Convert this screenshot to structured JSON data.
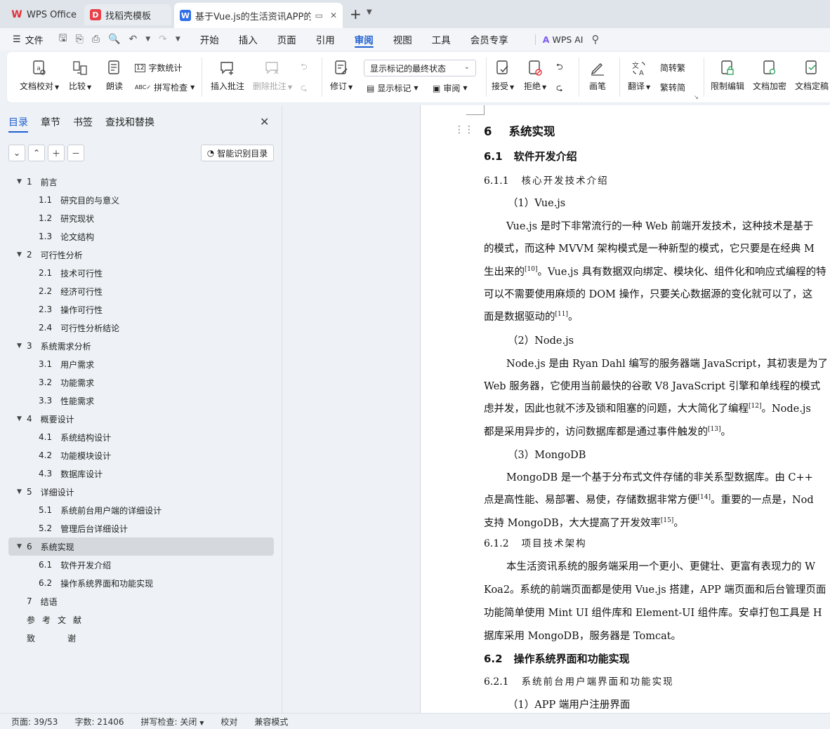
{
  "tabs": [
    {
      "label": "WPS Office",
      "icon": "wps-logo-icon"
    },
    {
      "label": "找稻壳模板",
      "icon": "docer-icon"
    },
    {
      "label": "基于Vue.js的生活资讯APP的设",
      "icon": "writer-doc-icon"
    }
  ],
  "menu": {
    "file_label": "文件",
    "tabs": [
      "开始",
      "插入",
      "页面",
      "引用",
      "审阅",
      "视图",
      "工具",
      "会员专享"
    ],
    "active_tab": "审阅",
    "ai_label": "WPS AI"
  },
  "ribbon": {
    "doc_check": "文档校对",
    "compare": "比较",
    "read_aloud": "朗读",
    "word_count": "字数统计",
    "spell_check": "拼写检查",
    "insert_comment": "插入批注",
    "delete_comment": "删除批注",
    "track_changes": "修订",
    "markup_state": "显示标记的最终状态",
    "show_markup": "显示标记",
    "review_pane": "审阅",
    "accept": "接受",
    "reject": "拒绝",
    "pen": "画笔",
    "translate": "翻译",
    "to_traditional": "简转繁",
    "to_simplified": "繁转简",
    "restrict_edit": "限制编辑",
    "encrypt": "文档加密",
    "finalize": "文档定稿"
  },
  "nav": {
    "tabs": [
      "目录",
      "章节",
      "书签",
      "查找和替换"
    ],
    "active_tab": "目录",
    "smart_toc": "智能识别目录",
    "toc": [
      {
        "num": "1",
        "title": "前言",
        "level": 1,
        "arrow": true
      },
      {
        "num": "1.1",
        "title": "研究目的与意义",
        "level": 2
      },
      {
        "num": "1.2",
        "title": "研究现状",
        "level": 2
      },
      {
        "num": "1.3",
        "title": "论文结构",
        "level": 2
      },
      {
        "num": "2",
        "title": "可行性分析",
        "level": 1,
        "arrow": true
      },
      {
        "num": "2.1",
        "title": "技术可行性",
        "level": 2
      },
      {
        "num": "2.2",
        "title": "经济可行性",
        "level": 2
      },
      {
        "num": "2.3",
        "title": "操作可行性",
        "level": 2
      },
      {
        "num": "2.4",
        "title": "可行性分析结论",
        "level": 2
      },
      {
        "num": "3",
        "title": "系统需求分析",
        "level": 1,
        "arrow": true
      },
      {
        "num": "3.1",
        "title": "用户需求",
        "level": 2
      },
      {
        "num": "3.2",
        "title": "功能需求",
        "level": 2
      },
      {
        "num": "3.3",
        "title": "性能需求",
        "level": 2
      },
      {
        "num": "4",
        "title": "概要设计",
        "level": 1,
        "arrow": true
      },
      {
        "num": "4.1",
        "title": "系统结构设计",
        "level": 2
      },
      {
        "num": "4.2",
        "title": "功能模块设计",
        "level": 2
      },
      {
        "num": "4.3",
        "title": "数据库设计",
        "level": 2
      },
      {
        "num": "5",
        "title": "详细设计",
        "level": 1,
        "arrow": true
      },
      {
        "num": "5.1",
        "title": "系统前台用户端的详细设计",
        "level": 2
      },
      {
        "num": "5.2",
        "title": "管理后台详细设计",
        "level": 2
      },
      {
        "num": "6",
        "title": "系统实现",
        "level": 1,
        "arrow": true,
        "selected": true
      },
      {
        "num": "6.1",
        "title": "软件开发介绍",
        "level": 2
      },
      {
        "num": "6.2",
        "title": "操作系统界面和功能实现",
        "level": 2
      },
      {
        "num": "7",
        "title": "结语",
        "level": 1,
        "arrow": false
      },
      {
        "num": "",
        "title": "参考文献",
        "level": 1,
        "arrow": false,
        "spaced": true
      },
      {
        "num": "",
        "title": "致谢",
        "level": 1,
        "arrow": false,
        "wide": true
      }
    ]
  },
  "document": {
    "lines": [
      {
        "type": "h1",
        "num": "6",
        "text": "系统实现"
      },
      {
        "type": "h2",
        "num": "6.1",
        "text": "软件开发介绍"
      },
      {
        "type": "h3",
        "num": "6.1.1",
        "text": "核心开发技术介绍"
      },
      {
        "type": "sub",
        "text": "（1）Vue.js"
      },
      {
        "type": "p",
        "indent": true,
        "text": "Vue.js 是时下非常流行的一种 Web 前端开发技术，这种技术是基于"
      },
      {
        "type": "p",
        "text": "的模式，而这种 MVVM 架构模式是一种新型的模式，它只要是在经典 M"
      },
      {
        "type": "p",
        "text": "生出来的",
        "sup": "[10]",
        "after": "。Vue.js 具有数据双向绑定、模块化、组件化和响应式编程的特"
      },
      {
        "type": "p",
        "text": "可以不需要使用麻烦的 DOM 操作，只要关心数据源的变化就可以了，这"
      },
      {
        "type": "p",
        "text": "面是数据驱动的",
        "sup": "[11]",
        "after": "。"
      },
      {
        "type": "sub",
        "text": "（2）Node.js"
      },
      {
        "type": "p",
        "indent": true,
        "text": "Node.js 是由 Ryan Dahl 编写的服务器端 JavaScript，其初衷是为了"
      },
      {
        "type": "p",
        "text": "Web  服务器，它使用当前最快的谷歌 V8 JavaScript 引擎和单线程的模式"
      },
      {
        "type": "p",
        "text": "虑并发，因此也就不涉及锁和阻塞的问题，大大简化了编程",
        "sup": "[12]",
        "after": "。Node.js"
      },
      {
        "type": "p",
        "text": "都是采用异步的，访问数据库都是通过事件触发的",
        "sup": "[13]",
        "after": "。"
      },
      {
        "type": "sub",
        "text": "（3）MongoDB"
      },
      {
        "type": "p",
        "indent": true,
        "text": "MongoDB 是一个基于分布式文件存储的非关系型数据库。由 C++"
      },
      {
        "type": "p",
        "text": "点是高性能、易部署、易使，存储数据非常方便",
        "sup": "[14]",
        "after": "。重要的一点是，Nod"
      },
      {
        "type": "p",
        "text": "支持 MongoDB，大大提高了开发效率",
        "sup": "[15]",
        "after": "。"
      },
      {
        "type": "h3",
        "num": "6.1.2",
        "text": "项目技术架构"
      },
      {
        "type": "p",
        "indent": true,
        "text": "本生活资讯系统的服务端采用一个更小、更健壮、更富有表现力的 W"
      },
      {
        "type": "p",
        "text": "Koa2。系统的前端页面都是使用 Vue.js 搭建，APP 端页面和后台管理页面"
      },
      {
        "type": "p",
        "text": "功能简单使用 Mint UI 组件库和 Element-UI 组件库。安卓打包工具是 H"
      },
      {
        "type": "p",
        "text": "据库采用 MongoDB，服务器是 Tomcat。"
      },
      {
        "type": "h2",
        "num": "6.2",
        "text": "操作系统界面和功能实现"
      },
      {
        "type": "h3",
        "num": "6.2.1",
        "text": "系统前台用户端界面和功能实现"
      },
      {
        "type": "sub",
        "text": "（1）APP 端用户注册界面"
      }
    ]
  },
  "status": {
    "page": "页面: 39/53",
    "words": "字数: 21406",
    "spell": "拼写检查: 关闭",
    "proofread": "校对",
    "compat": "兼容模式"
  }
}
